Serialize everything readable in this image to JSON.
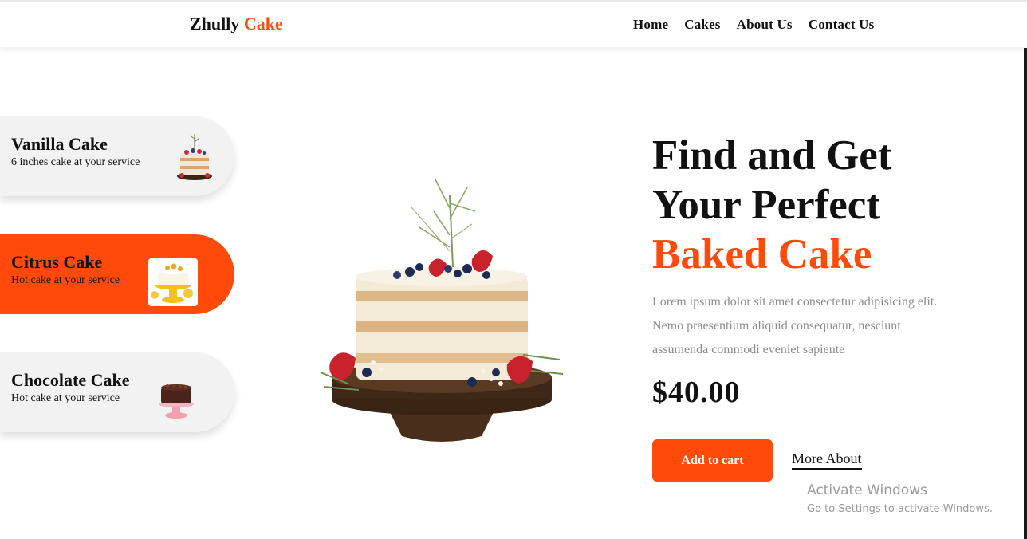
{
  "brand": {
    "name": "Zhully",
    "accent": "Cake"
  },
  "nav": [
    "Home",
    "Cakes",
    "About Us",
    "Contact Us"
  ],
  "cards": [
    {
      "title": "Vanilla Cake",
      "subtitle": "6 inches cake at your service"
    },
    {
      "title": "Citrus Cake",
      "subtitle": "Hot cake at your service"
    },
    {
      "title": "Chocolate Cake",
      "subtitle": "Hot cake at your service"
    }
  ],
  "hero": {
    "line1": "Find and Get",
    "line2": "Your Perfect",
    "line3": "Baked Cake",
    "description": "Lorem ipsum dolor sit amet consectetur adipisicing elit. Nemo praesentium aliquid consequatur, nesciunt assumenda commodi eveniet sapiente",
    "price": "$40.00",
    "cart_label": "Add to cart",
    "more_label": "More About"
  },
  "watermark": {
    "title": "Activate Windows",
    "subtitle": "Go to Settings to activate Windows."
  },
  "colors": {
    "accent": "#ff4a0a",
    "card_bg": "#f2f2f2",
    "text": "#111111",
    "muted": "#8c8c8c"
  },
  "icons": [
    "vanilla-cake-image",
    "citrus-cake-image",
    "chocolate-cake-image",
    "hero-cake-image"
  ]
}
